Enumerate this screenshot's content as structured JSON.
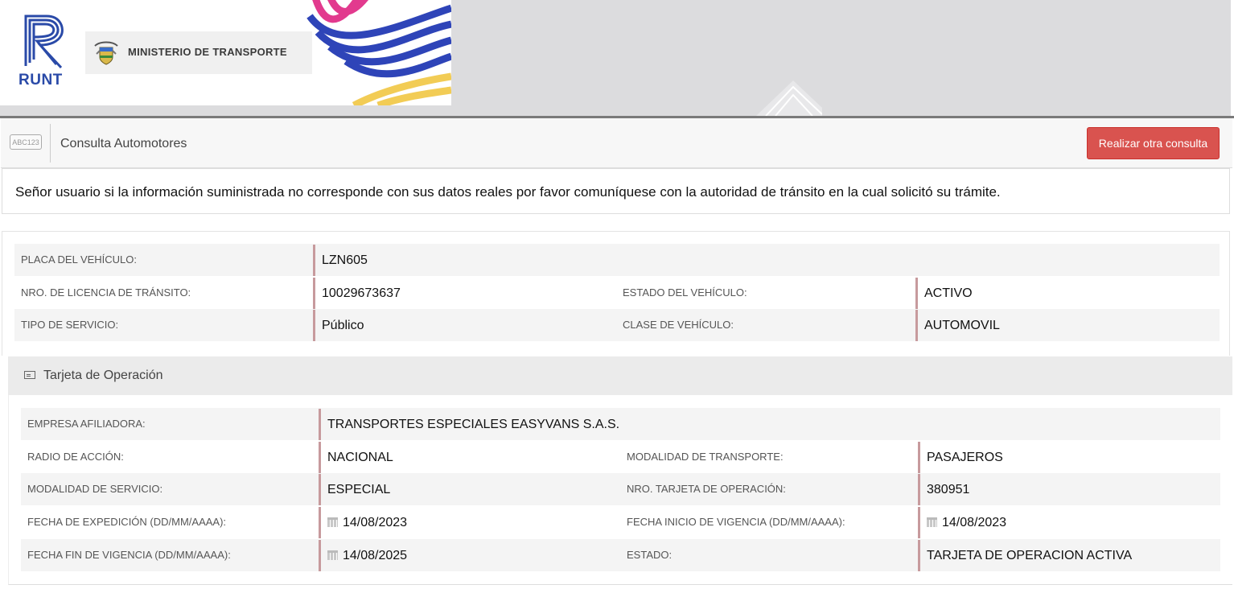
{
  "header": {
    "logo_text": "RUNT",
    "ministry_text": "MINISTERIO DE TRANSPORTE"
  },
  "toolbar": {
    "icon_text": "ABC123",
    "title": "Consulta Automotores",
    "button_label": "Realizar otra consulta"
  },
  "notice": {
    "text": "Señor usuario si la información suministrada no corresponde con sus datos reales por favor comuníquese con la autoridad de tránsito en la cual solicitó su trámite."
  },
  "vehicle": {
    "placa_label": "PLACA DEL VEHÍCULO:",
    "placa_value": "LZN605",
    "licencia_label": "NRO. DE LICENCIA DE TRÁNSITO:",
    "licencia_value": "10029673637",
    "estado_label": "ESTADO DEL VEHÍCULO:",
    "estado_value": "ACTIVO",
    "servicio_label": "TIPO DE SERVICIO:",
    "servicio_value": "Público",
    "clase_label": "CLASE DE VEHÍCULO:",
    "clase_value": "AUTOMOVIL"
  },
  "tarjeta": {
    "title": "Tarjeta de Operación",
    "empresa_label": "EMPRESA AFILIADORA:",
    "empresa_value": "TRANSPORTES ESPECIALES EASYVANS S.A.S.",
    "radio_label": "RADIO DE ACCIÓN:",
    "radio_value": "NACIONAL",
    "modalidad_transporte_label": "MODALIDAD DE TRANSPORTE:",
    "modalidad_transporte_value": "PASAJEROS",
    "modalidad_servicio_label": "MODALIDAD DE SERVICIO:",
    "modalidad_servicio_value": "ESPECIAL",
    "nro_tarjeta_label": "NRO. TARJETA DE OPERACIÓN:",
    "nro_tarjeta_value": "380951",
    "fecha_expedicion_label": "FECHA DE EXPEDICIÓN (DD/MM/AAAA):",
    "fecha_expedicion_value": "14/08/2023",
    "fecha_inicio_label": "FECHA INICIO DE VIGENCIA (DD/MM/AAAA):",
    "fecha_inicio_value": "14/08/2023",
    "fecha_fin_label": "FECHA FIN DE VIGENCIA (DD/MM/AAAA):",
    "fecha_fin_value": "14/08/2025",
    "estado_label": "ESTADO:",
    "estado_value": "TARJETA DE OPERACION ACTIVA"
  }
}
